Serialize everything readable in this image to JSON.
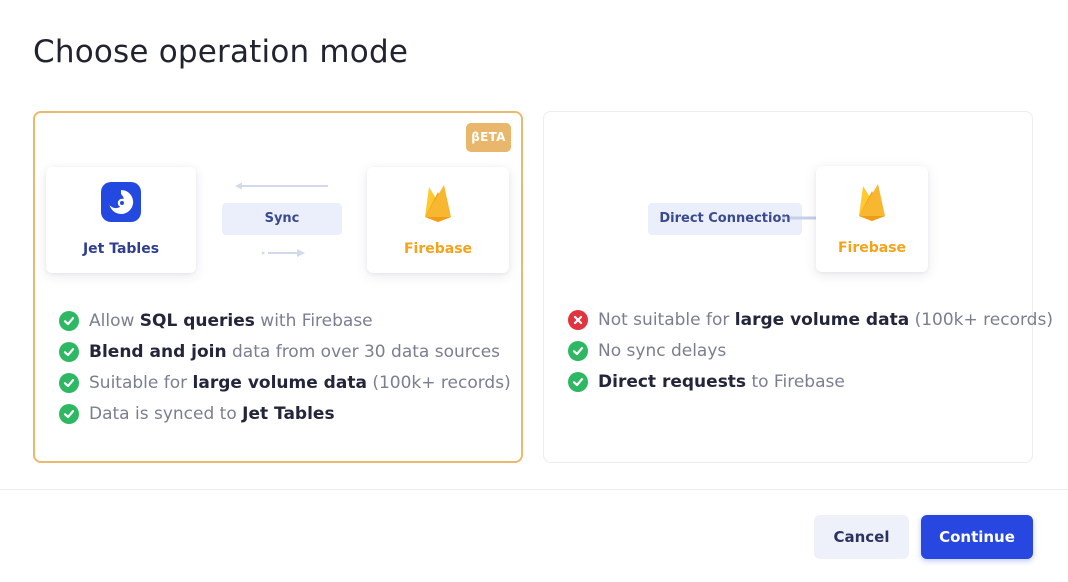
{
  "dialog": {
    "title": "Choose operation mode"
  },
  "mode_sync": {
    "badge": "βETA",
    "source_label": "Jet Tables",
    "connector_label": "Sync",
    "target_label": "Firebase",
    "features": [
      {
        "status": "check",
        "parts": [
          {
            "t": "Allow ",
            "b": false
          },
          {
            "t": "SQL queries",
            "b": true
          },
          {
            "t": " with Firebase",
            "b": false
          }
        ]
      },
      {
        "status": "check",
        "parts": [
          {
            "t": "Blend and join",
            "b": true
          },
          {
            "t": " data from over 30 data sources",
            "b": false
          }
        ]
      },
      {
        "status": "check",
        "parts": [
          {
            "t": "Suitable for ",
            "b": false
          },
          {
            "t": "large volume data",
            "b": true
          },
          {
            "t": " (100k+ records)",
            "b": false
          }
        ]
      },
      {
        "status": "check",
        "parts": [
          {
            "t": "Data is synced to ",
            "b": false
          },
          {
            "t": "Jet Tables",
            "b": true
          }
        ]
      }
    ]
  },
  "mode_direct": {
    "connector_label": "Direct Connection",
    "target_label": "Firebase",
    "features": [
      {
        "status": "cross",
        "parts": [
          {
            "t": "Not suitable for ",
            "b": false
          },
          {
            "t": "large volume data",
            "b": true
          },
          {
            "t": " (100k+ records)",
            "b": false
          }
        ]
      },
      {
        "status": "check",
        "parts": [
          {
            "t": "No sync delays",
            "b": false
          }
        ]
      },
      {
        "status": "check",
        "parts": [
          {
            "t": "Direct requests",
            "b": true
          },
          {
            "t": " to Firebase",
            "b": false
          }
        ]
      }
    ]
  },
  "footer": {
    "cancel_label": "Cancel",
    "continue_label": "Continue"
  },
  "colors": {
    "selected_border": "#e9b96e",
    "primary": "#2747e0",
    "check": "#2fb864",
    "cross": "#e0353f",
    "firebase": "#f5a31b"
  },
  "icons": {
    "source": "jet-tables-logo-icon",
    "target": "firebase-logo-icon"
  }
}
